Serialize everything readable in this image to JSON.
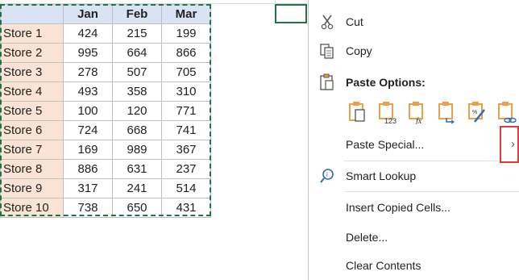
{
  "table": {
    "headers": [
      "Jan",
      "Feb",
      "Mar"
    ],
    "rows": [
      {
        "store": "Store 1",
        "vals": [
          "424",
          "215",
          "199"
        ]
      },
      {
        "store": "Store 2",
        "vals": [
          "995",
          "664",
          "866"
        ]
      },
      {
        "store": "Store 3",
        "vals": [
          "278",
          "507",
          "705"
        ]
      },
      {
        "store": "Store 4",
        "vals": [
          "493",
          "358",
          "310"
        ]
      },
      {
        "store": "Store 5",
        "vals": [
          "100",
          "120",
          "771"
        ]
      },
      {
        "store": "Store 6",
        "vals": [
          "724",
          "668",
          "741"
        ]
      },
      {
        "store": "Store 7",
        "vals": [
          "169",
          "989",
          "367"
        ]
      },
      {
        "store": "Store 8",
        "vals": [
          "886",
          "631",
          "237"
        ]
      },
      {
        "store": "Store 9",
        "vals": [
          "317",
          "241",
          "514"
        ]
      },
      {
        "store": "Store 10",
        "vals": [
          "738",
          "650",
          "431"
        ]
      }
    ]
  },
  "menu": {
    "cut": "Cut",
    "copy": "Copy",
    "paste_options": "Paste Options:",
    "paste_special": "Paste Special...",
    "smart_lookup": "Smart Lookup",
    "insert_copied": "Insert Copied Cells...",
    "delete": "Delete...",
    "clear_contents": "Clear Contents",
    "submenu_arrow": "›"
  },
  "colors": {
    "header_fill": "#dae3f3",
    "store_fill": "#fbe4d5",
    "marquee": "#217346",
    "highlight": "#e03c3c",
    "clipboard_orange": "#e8a24a"
  }
}
